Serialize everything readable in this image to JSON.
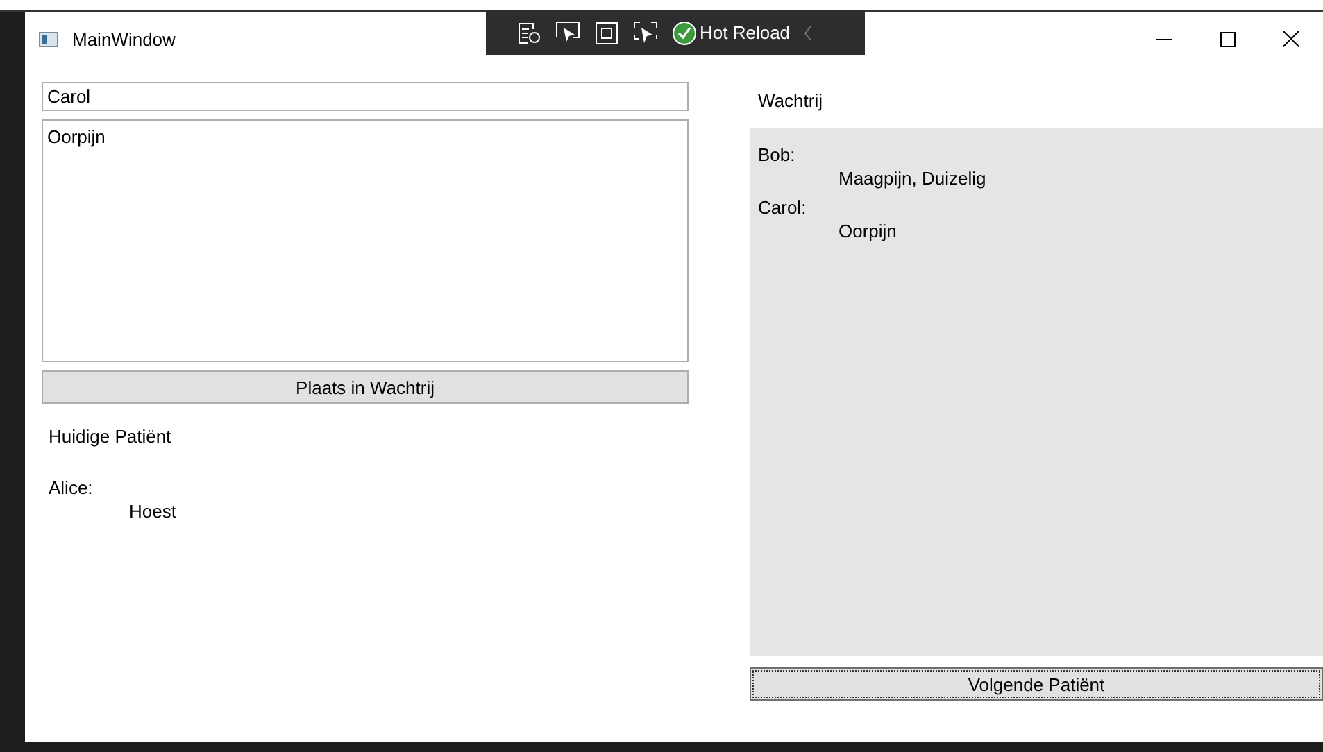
{
  "window": {
    "title": "MainWindow"
  },
  "toolbar": {
    "hot_reload": "Hot Reload"
  },
  "form": {
    "name": "Carol",
    "complaints": "Oorpijn",
    "button": "Plaats in Wachtrij"
  },
  "current": {
    "heading": "Huidige Patiënt",
    "patient": {
      "name": "Alice:",
      "complaints": "Hoest"
    }
  },
  "queue": {
    "heading": "Wachtrij",
    "patients": [
      {
        "name": "Bob:",
        "complaints": "Maagpijn, Duizelig"
      },
      {
        "name": "Carol:",
        "complaints": "Oorpijn"
      }
    ],
    "button": "Volgende Patiënt",
    "button_focused": true
  }
}
